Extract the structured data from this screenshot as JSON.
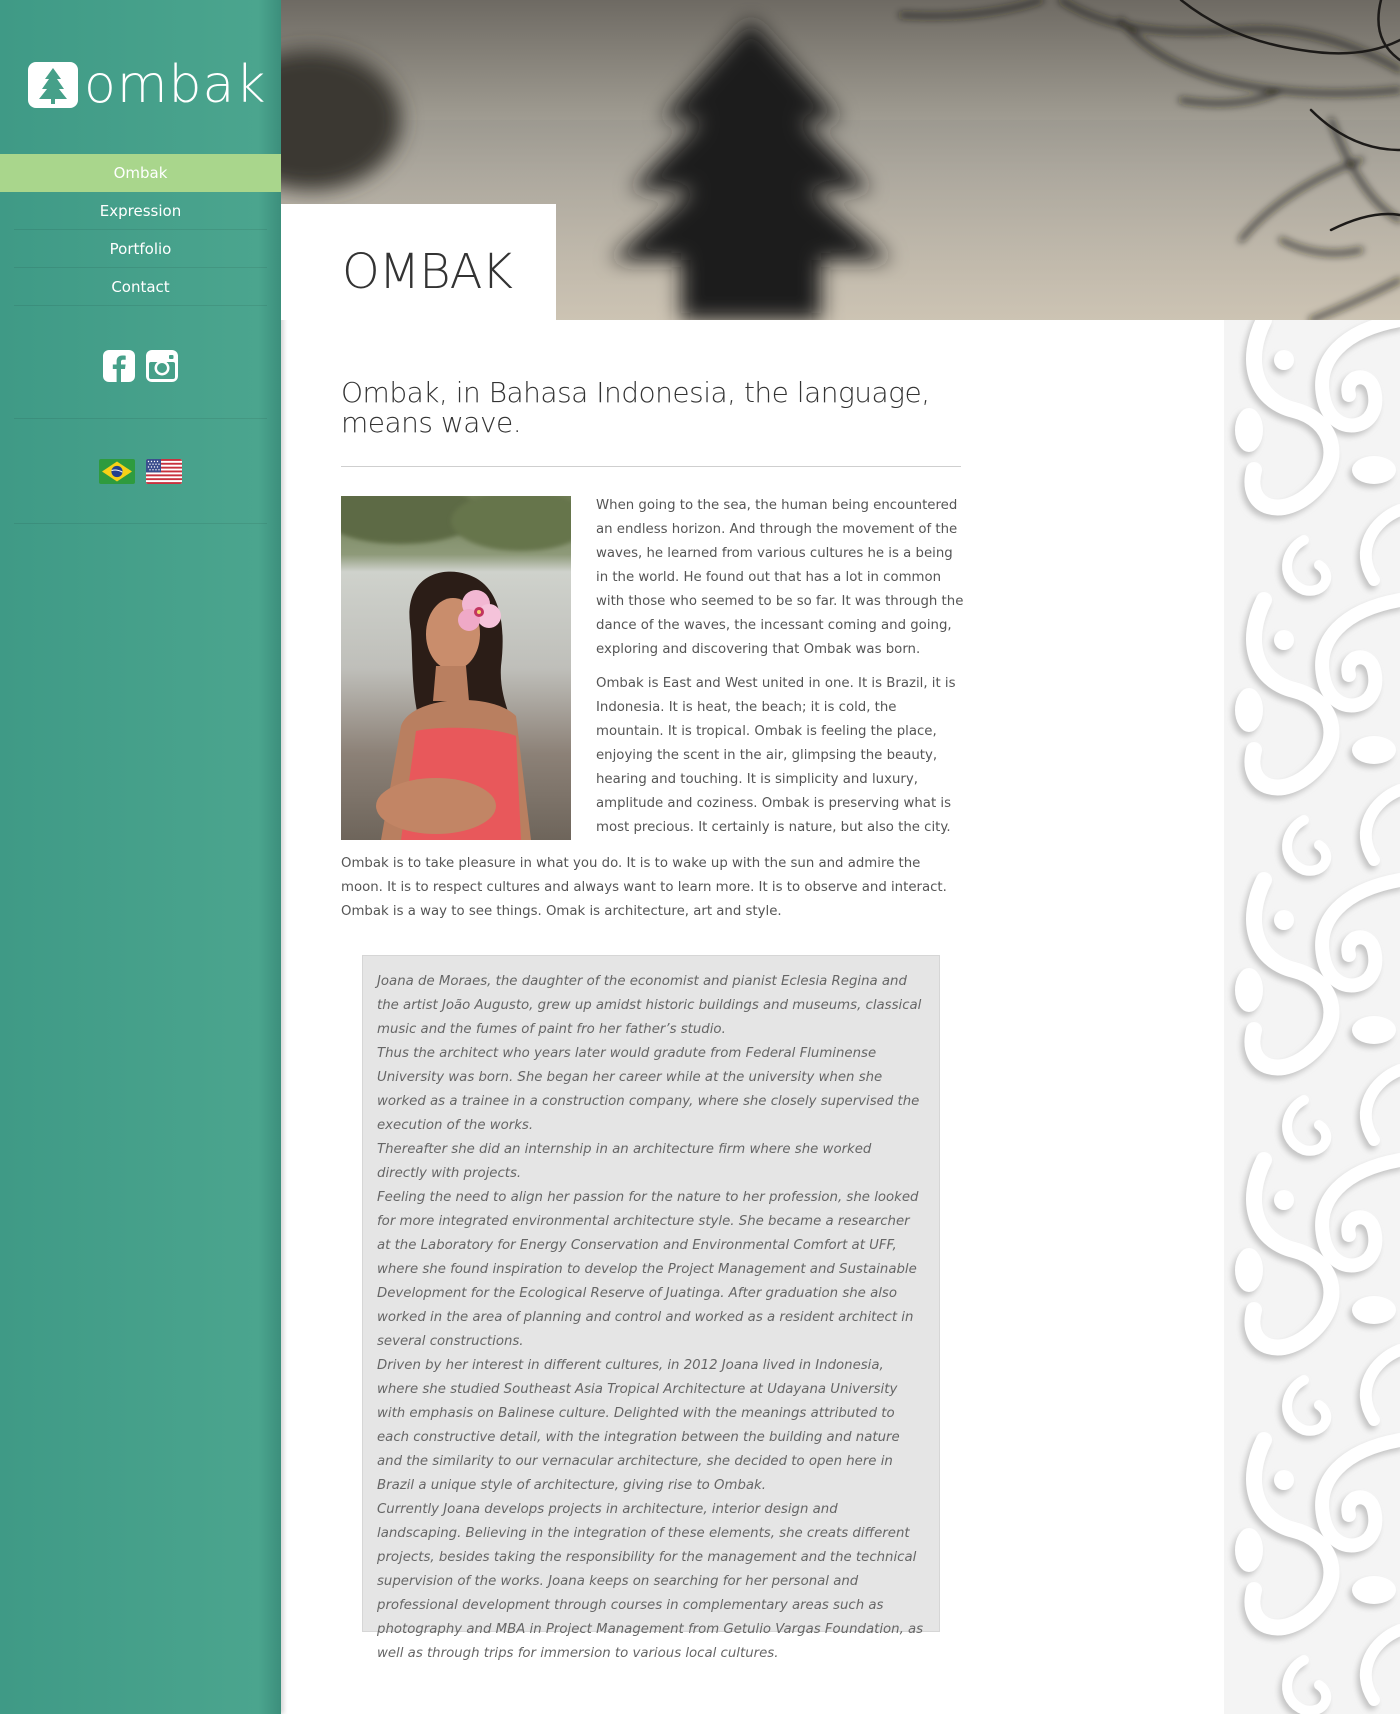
{
  "brand": {
    "name": "ombak",
    "logo_icon": "pine-tree-icon"
  },
  "nav": {
    "items": [
      {
        "label": "Ombak",
        "active": true
      },
      {
        "label": "Expression",
        "active": false
      },
      {
        "label": "Portfolio",
        "active": false
      },
      {
        "label": "Contact",
        "active": false
      }
    ]
  },
  "social": [
    {
      "icon": "facebook-icon"
    },
    {
      "icon": "instagram-icon"
    }
  ],
  "languages": [
    {
      "icon": "brazil-flag-icon"
    },
    {
      "icon": "usa-flag-icon"
    }
  ],
  "hero": {
    "title": "OMBAK"
  },
  "content": {
    "lead": "Ombak, in Bahasa Indonesia, the language, means wave.",
    "paragraphs": [
      "When going to the sea, the human being encountered an endless horizon. And through the movement of the waves, he learned from various cultures he is a being in the world. He found out that has a lot in common with those who seemed to be so far. It was through the dance of the waves, the incessant coming and going, exploring and discovering that Ombak was born.",
      "Ombak is East and West united in one. It is Brazil, it is Indonesia. It is heat, the beach; it is cold, the mountain. It is tropical. Ombak is feeling the place, enjoying the scent in the air, glimpsing the beauty, hearing and touching. It is simplicity and luxury, amplitude and coziness. Ombak is preserving what is most precious. It certainly is nature, but also the city.",
      "Ombak is to take pleasure in what you do. It is to wake up with the sun and admire the moon. It is to respect cultures and always want to learn more. It is to observe and interact. Ombak is a way to see things. Omak is architecture, art and style."
    ]
  },
  "bio": {
    "paragraphs": [
      "Joana de Moraes, the daughter of the economist and pianist Eclesia Regina and the artist João Augusto, grew up amidst historic buildings and museums, classical music and the fumes of paint fro her father’s studio.",
      "Thus the architect who years later would gradute from Federal Fluminense University was born. She began her career while at the university when she worked as a trainee in a construction company, where she closely supervised the execution of the works.",
      "Thereafter she did an internship in an architecture firm where she worked directly with projects.",
      "Feeling the need to align her passion for the nature to her profession, she looked for more integrated environmental architecture style. She became a researcher at the Laboratory for Energy Conservation and Environmental Comfort at UFF, where she found inspiration to develop the Project Management and Sustainable Development for the Ecological Reserve of Juatinga. After graduation she also worked in the area of planning and control and worked as a resident architect in several constructions.",
      "Driven by her interest in different cultures, in 2012 Joana lived in Indonesia, where she studied Southeast Asia Tropical Architecture at Udayana University with emphasis on Balinese culture. Delighted with the meanings attributed to each constructive detail, with the integration between the building and nature and the similarity to our vernacular architecture, she decided to open here in Brazil a unique style of architecture, giving rise to Ombak.",
      "Currently Joana develops projects in architecture, interior design and landscaping. Believing in the integration of these elements, she creats different projects, besides taking the responsibility for the management and the technical supervision of the works. Joana keeps on searching for her personal and professional development through courses in complementary areas such as photography and MBA in Project Management from Getulio Vargas Foundation, as well as through trips for immersion to various local cultures."
    ]
  },
  "colors": {
    "sidebar": "#46a089",
    "nav_active": "#a9d68c",
    "bio_box": "#e5e5e5"
  }
}
